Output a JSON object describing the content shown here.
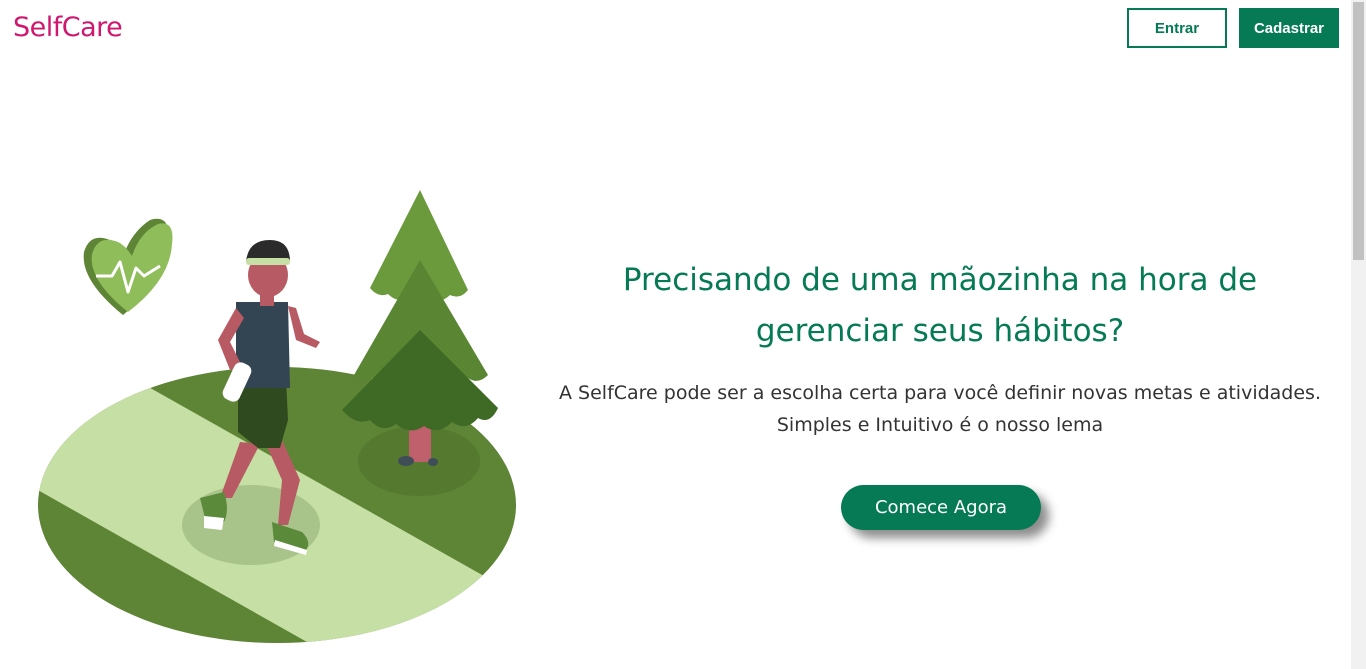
{
  "header": {
    "logo": "SelfCare",
    "login_label": "Entrar",
    "signup_label": "Cadastrar"
  },
  "hero": {
    "headline": "Precisando de uma mãozinha na hora de gerenciar seus hábitos?",
    "subtext_line1": "A SelfCare pode ser a escolha certa para você definir novas metas e atividades.",
    "subtext_line2": "Simples e Intuitivo é o nosso lema",
    "cta_label": "Comece Agora"
  },
  "colors": {
    "brand_pink": "#d0176f",
    "brand_green": "#057a55",
    "illustration_dark_green": "#5e8436",
    "illustration_light_green": "#c5dfa4"
  },
  "icons": [
    "heart-pulse-icon",
    "tree-icon",
    "runner-illustration"
  ]
}
